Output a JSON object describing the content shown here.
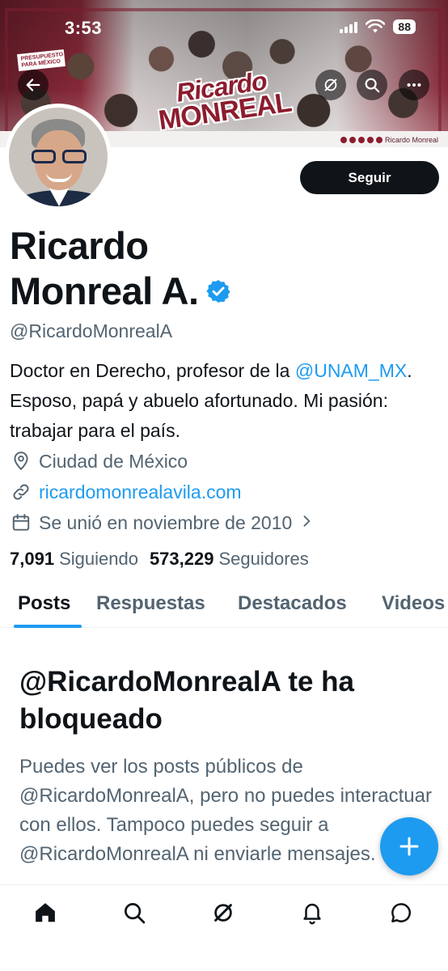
{
  "status_bar": {
    "time": "3:53",
    "battery": "88"
  },
  "banner": {
    "logo_line1": "Ricardo",
    "logo_line2": "MONREAL",
    "signature": "Ricardo Monreal",
    "placard": "PRESUPUESTO PARA MÉXICO"
  },
  "actions": {
    "follow_label": "Seguir"
  },
  "profile": {
    "name_line1": "Ricardo",
    "name_line2": "Monreal A.",
    "handle": "@RicardoMonrealA",
    "bio_before": "Doctor en Derecho, profesor de la ",
    "bio_mention": "@UNAM_MX",
    "bio_after": ". Esposo, papá y abuelo afortunado. Mi pasión: trabajar para el país.",
    "location": "Ciudad de México",
    "website": "ricardomonrealavila.com",
    "joined": "Se unió en noviembre de 2010",
    "following_count": "7,091",
    "following_label": "Siguiendo",
    "followers_count": "573,229",
    "followers_label": "Seguidores"
  },
  "tabs": [
    {
      "label": "Posts",
      "active": true
    },
    {
      "label": "Respuestas",
      "active": false
    },
    {
      "label": "Destacados",
      "active": false
    },
    {
      "label": "Videos",
      "active": false
    }
  ],
  "blocked": {
    "title": "@RicardoMonrealA te ha bloqueado",
    "body": "Puedes ver los posts públicos de @RicardoMonrealA, pero no puedes interactuar con ellos. Tampoco puedes seguir a @RicardoMonrealA ni enviarle mensajes."
  },
  "colors": {
    "accent": "#1d9bf0",
    "text": "#0f1419",
    "secondary": "#536471",
    "brand": "#8c1c2e"
  },
  "icons": {
    "back": "arrow-left-icon",
    "grok": "grok-icon",
    "search": "search-icon",
    "more": "more-icon",
    "verified": "verified-badge-icon",
    "location": "location-pin-icon",
    "link": "link-icon",
    "calendar": "calendar-icon",
    "compose": "plus-icon",
    "nav": [
      "home-icon",
      "search-icon",
      "grok-icon",
      "bell-icon",
      "messages-icon"
    ]
  }
}
